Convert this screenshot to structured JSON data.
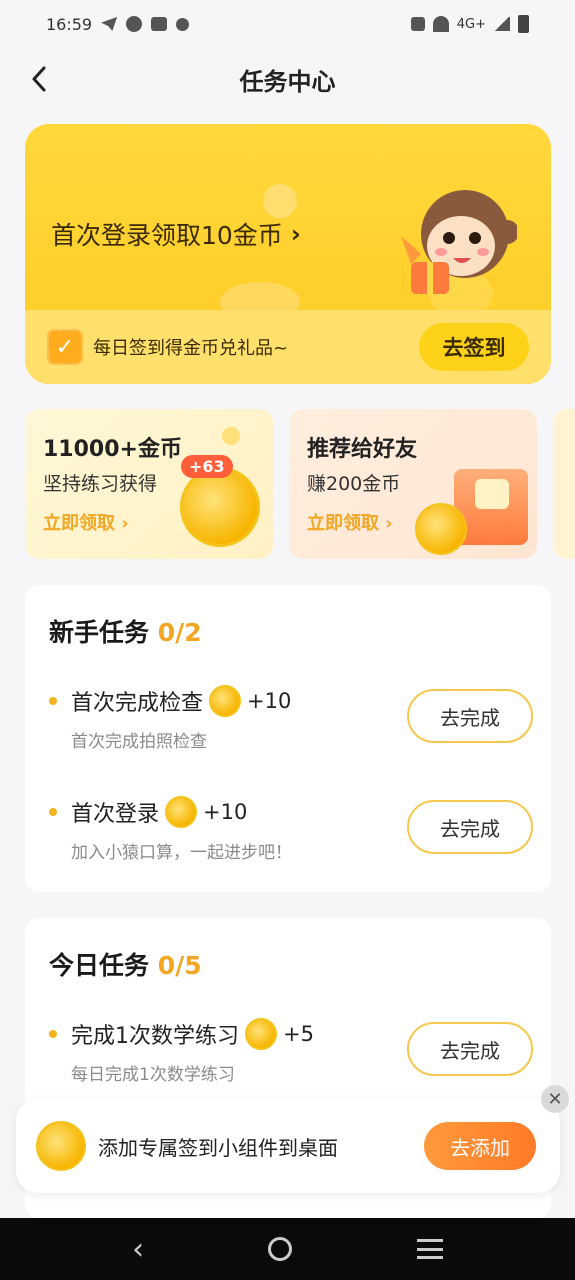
{
  "status_bar": {
    "time": "16:59",
    "network": "4G+"
  },
  "header": {
    "title": "任务中心"
  },
  "banner": {
    "title": "首次登录领取10金币",
    "checkin_text": "每日签到得金币兑礼品~",
    "checkin_button": "去签到"
  },
  "promos": [
    {
      "title": "11000+金币",
      "subtitle": "坚持练习获得",
      "link": "立即领取",
      "badge": "+63"
    },
    {
      "title": "推荐给好友",
      "subtitle": "赚200金币",
      "link": "立即领取"
    }
  ],
  "newbie": {
    "title": "新手任务",
    "count": "0/2",
    "tasks": [
      {
        "title": "首次完成检查",
        "reward": "+10",
        "desc": "首次完成拍照检查",
        "button": "去完成"
      },
      {
        "title": "首次登录",
        "reward": "+10",
        "desc": "加入小猿口算，一起进步吧！",
        "button": "去完成"
      }
    ]
  },
  "daily": {
    "title": "今日任务",
    "count": "0/5",
    "tasks": [
      {
        "title": "完成1次数学练习",
        "reward": "+5",
        "desc": "每日完成1次数学练习",
        "button": "去完成"
      }
    ]
  },
  "popup": {
    "text": "添加专属签到小组件到桌面",
    "button": "去添加",
    "close": "✕"
  },
  "icons": {
    "back": "chevron-left-icon",
    "calendar": "calendar-check-icon",
    "coin": "gold-coin-icon"
  },
  "colors": {
    "accent": "#f2a623",
    "banner": "#ffd83d",
    "button_orange": "#ff7a28"
  }
}
